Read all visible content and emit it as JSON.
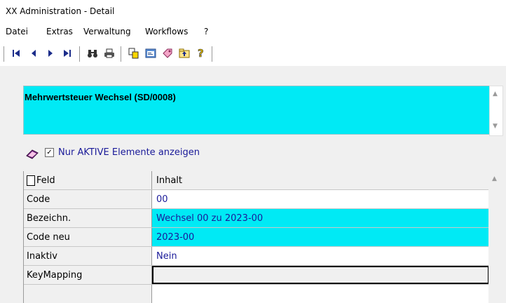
{
  "window": {
    "title": "XX Administration - Detail"
  },
  "menu": {
    "items": [
      "Datei",
      "Extras",
      "Verwaltung",
      "Workflows",
      "?"
    ]
  },
  "toolbar": {
    "buttons": [
      "first-record-icon",
      "prev-record-icon",
      "next-record-icon",
      "last-record-icon",
      "search-binoculars-icon",
      "print-icon",
      "copy-record-icon",
      "properties-icon",
      "tag-icon",
      "folder-up-icon",
      "help-icon"
    ]
  },
  "header": {
    "title": "Mehrwertsteuer Wechsel (SD/0008)",
    "background": "#00eaf5"
  },
  "filter": {
    "checked": true,
    "label": "Nur AKTIVE Elemente anzeigen"
  },
  "table": {
    "columns": [
      "Feld",
      "Inhalt"
    ],
    "rows": [
      {
        "field": "Code",
        "value": "00"
      },
      {
        "field": "Bezeichn.",
        "value": "Wechsel 00 zu 2023-00"
      },
      {
        "field": "Code neu",
        "value": "2023-00"
      },
      {
        "field": "Inaktiv",
        "value": "Nein"
      },
      {
        "field": "KeyMapping",
        "value": ""
      }
    ]
  }
}
